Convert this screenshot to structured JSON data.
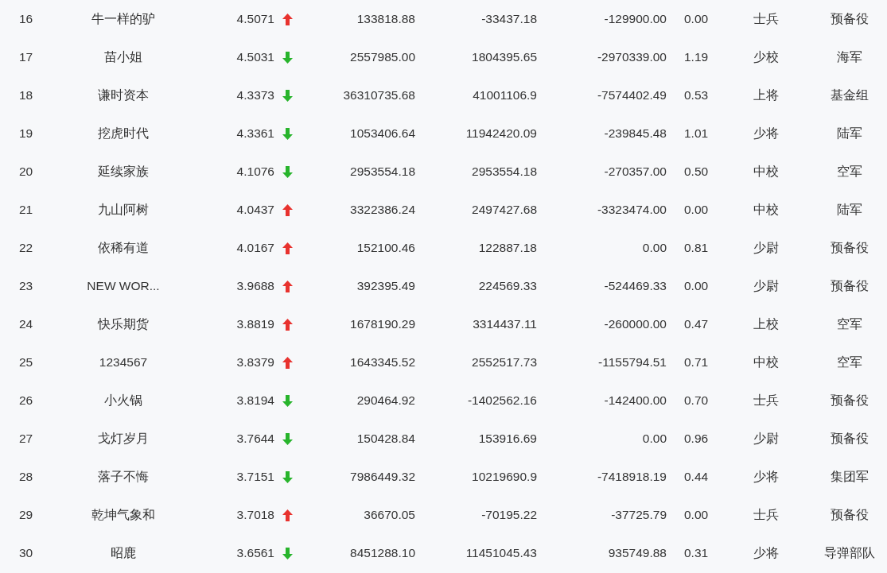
{
  "table": {
    "rows": [
      {
        "column_1": "16",
        "column_2": "牛一样的驴",
        "column_3": "4.5071",
        "rising": true,
        "column_4": "133818.88",
        "column_5": "-33437.18",
        "column_6": "-129900.00",
        "column_7": "0.00",
        "column_8": "士兵",
        "column_9": "预备役"
      },
      {
        "column_1": "17",
        "column_2": "苗小姐",
        "column_3": "4.5031",
        "rising": false,
        "column_4": "2557985.00",
        "column_5": "1804395.65",
        "column_6": "-2970339.00",
        "column_7": "1.19",
        "column_8": "少校",
        "column_9": "海军"
      },
      {
        "column_1": "18",
        "column_2": "谦时资本",
        "column_3": "4.3373",
        "rising": false,
        "column_4": "36310735.68",
        "column_5": "41001106.9",
        "column_6": "-7574402.49",
        "column_7": "0.53",
        "column_8": "上将",
        "column_9": "基金组"
      },
      {
        "column_1": "19",
        "column_2": "挖虎时代",
        "column_3": "4.3361",
        "rising": false,
        "column_4": "1053406.64",
        "column_5": "11942420.09",
        "column_6": "-239845.48",
        "column_7": "1.01",
        "column_8": "少将",
        "column_9": "陆军"
      },
      {
        "column_1": "20",
        "column_2": "延续家族",
        "column_3": "4.1076",
        "rising": false,
        "column_4": "2953554.18",
        "column_5": "2953554.18",
        "column_6": "-270357.00",
        "column_7": "0.50",
        "column_8": "中校",
        "column_9": "空军"
      },
      {
        "column_1": "21",
        "column_2": "九山阿树",
        "column_3": "4.0437",
        "rising": true,
        "column_4": "3322386.24",
        "column_5": "2497427.68",
        "column_6": "-3323474.00",
        "column_7": "0.00",
        "column_8": "中校",
        "column_9": "陆军"
      },
      {
        "column_1": "22",
        "column_2": "依稀有道",
        "column_3": "4.0167",
        "rising": true,
        "column_4": "152100.46",
        "column_5": "122887.18",
        "column_6": "0.00",
        "column_7": "0.81",
        "column_8": "少尉",
        "column_9": "预备役"
      },
      {
        "column_1": "23",
        "column_2": "NEW WOR...",
        "column_3": "3.9688",
        "rising": true,
        "column_4": "392395.49",
        "column_5": "224569.33",
        "column_6": "-524469.33",
        "column_7": "0.00",
        "column_8": "少尉",
        "column_9": "预备役"
      },
      {
        "column_1": "24",
        "column_2": "快乐期货",
        "column_3": "3.8819",
        "rising": true,
        "column_4": "1678190.29",
        "column_5": "3314437.11",
        "column_6": "-260000.00",
        "column_7": "0.47",
        "column_8": "上校",
        "column_9": "空军"
      },
      {
        "column_1": "25",
        "column_2": "1234567",
        "column_3": "3.8379",
        "rising": true,
        "column_4": "1643345.52",
        "column_5": "2552517.73",
        "column_6": "-1155794.51",
        "column_7": "0.71",
        "column_8": "中校",
        "column_9": "空军"
      },
      {
        "column_1": "26",
        "column_2": "小火锅",
        "column_3": "3.8194",
        "rising": false,
        "column_4": "290464.92",
        "column_5": "-1402562.16",
        "column_6": "-142400.00",
        "column_7": "0.70",
        "column_8": "士兵",
        "column_9": "预备役"
      },
      {
        "column_1": "27",
        "column_2": "戈灯岁月",
        "column_3": "3.7644",
        "rising": false,
        "column_4": "150428.84",
        "column_5": "153916.69",
        "column_6": "0.00",
        "column_7": "0.96",
        "column_8": "少尉",
        "column_9": "预备役"
      },
      {
        "column_1": "28",
        "column_2": "落子不悔",
        "column_3": "3.7151",
        "rising": false,
        "column_4": "7986449.32",
        "column_5": "10219690.9",
        "column_6": "-7418918.19",
        "column_7": "0.44",
        "column_8": "少将",
        "column_9": "集团军"
      },
      {
        "column_1": "29",
        "column_2": "乾坤气象和",
        "column_3": "3.7018",
        "rising": true,
        "column_4": "36670.05",
        "column_5": "-70195.22",
        "column_6": "-37725.79",
        "column_7": "0.00",
        "column_8": "士兵",
        "column_9": "预备役"
      },
      {
        "column_1": "30",
        "column_2": "昭鹿",
        "column_3": "3.6561",
        "rising": false,
        "column_4": "8451288.10",
        "column_5": "11451045.43",
        "column_6": "935749.88",
        "column_7": "0.31",
        "column_8": "少将",
        "column_9": "导弹部队"
      }
    ]
  }
}
